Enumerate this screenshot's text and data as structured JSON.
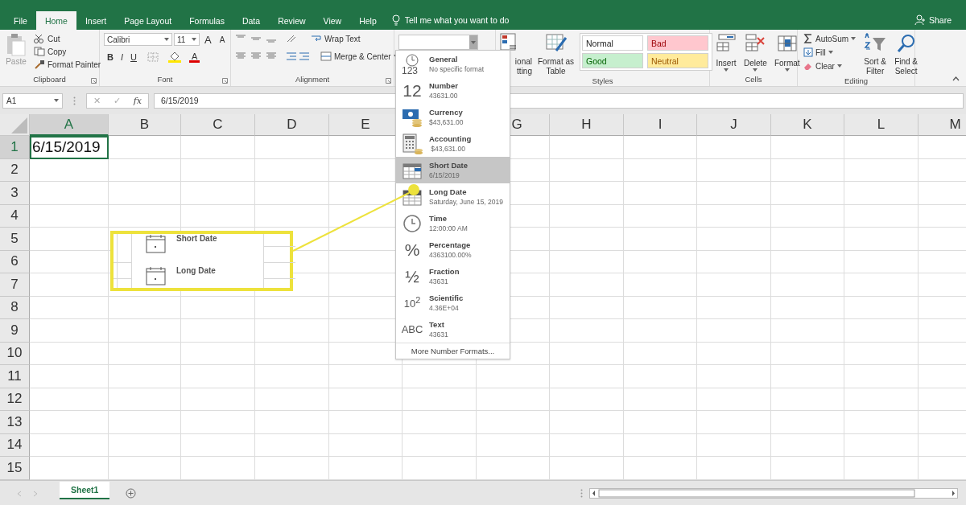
{
  "menu_tabs": [
    {
      "label": "File",
      "selected": false
    },
    {
      "label": "Home",
      "selected": true
    },
    {
      "label": "Insert",
      "selected": false
    },
    {
      "label": "Page Layout",
      "selected": false
    },
    {
      "label": "Formulas",
      "selected": false
    },
    {
      "label": "Data",
      "selected": false
    },
    {
      "label": "Review",
      "selected": false
    },
    {
      "label": "View",
      "selected": false
    },
    {
      "label": "Help",
      "selected": false
    }
  ],
  "tell_me": {
    "placeholder": "Tell me what you want to do"
  },
  "share": {
    "label": "Share"
  },
  "ribbon": [
    {
      "kind": "clipboard",
      "label": "Clipboard",
      "paste": {
        "label": "Paste",
        "disabled": true
      },
      "buttons": [
        {
          "kind": "cut",
          "label": "Cut"
        },
        {
          "kind": "copy",
          "label": "Copy"
        },
        {
          "kind": "painter",
          "label": "Format Painter"
        }
      ]
    },
    {
      "kind": "font",
      "label": "Font",
      "font_name": "Calibri",
      "font_size": "11",
      "size_buttons": [
        "A",
        "A"
      ],
      "style_buttons": [
        "B",
        "I",
        "U"
      ],
      "font_color_letter": "A"
    },
    {
      "kind": "alignment",
      "label": "Alignment",
      "wrap": "Wrap Text",
      "merge": "Merge & Center"
    },
    {
      "kind": "number"
    },
    {
      "kind": "styles",
      "label": "Styles",
      "conditional": [
        "ional",
        "tting"
      ],
      "format_table": [
        "Format as",
        "Table"
      ],
      "cell_styles": [
        {
          "kind": "normal",
          "label": "Normal",
          "color": "#ffffff"
        },
        {
          "kind": "bad",
          "label": "Bad",
          "color": "#ffc7ce"
        },
        {
          "kind": "good",
          "label": "Good",
          "color": "#c6efce"
        },
        {
          "kind": "neutral",
          "label": "Neutral",
          "color": "#ffeb9c"
        }
      ]
    },
    {
      "kind": "cells",
      "label": "Cells",
      "buttons": [
        {
          "kind": "insert",
          "label": "Insert"
        },
        {
          "kind": "delete",
          "label": "Delete"
        },
        {
          "kind": "format",
          "label": "Format"
        }
      ]
    },
    {
      "kind": "editing",
      "label": "Editing",
      "small": [
        {
          "kind": "sum",
          "label": "AutoSum"
        },
        {
          "kind": "fill",
          "label": "Fill"
        },
        {
          "kind": "clear",
          "label": "Clear"
        }
      ],
      "big": [
        {
          "kind": "sort",
          "lines": [
            "Sort &",
            "Filter"
          ]
        },
        {
          "kind": "find",
          "lines": [
            "Find &",
            "Select"
          ]
        }
      ]
    }
  ],
  "formula_bar": {
    "name_box": "A1",
    "cancel": "✕",
    "enter": "✓",
    "fx": "fx",
    "value": "6/15/2019"
  },
  "columns": [
    {
      "label": "A",
      "selected": true
    },
    {
      "label": "B",
      "selected": false
    },
    {
      "label": "C",
      "selected": false
    },
    {
      "label": "D",
      "selected": false
    },
    {
      "label": "E",
      "selected": false
    },
    {
      "label": "G",
      "selected": false
    },
    {
      "label": "H",
      "selected": false
    },
    {
      "label": "I",
      "selected": false
    },
    {
      "label": "J",
      "selected": false
    },
    {
      "label": "K",
      "selected": false
    },
    {
      "label": "L",
      "selected": false
    },
    {
      "label": "M",
      "selected": false
    }
  ],
  "rows": [
    {
      "label": "1",
      "selected": true,
      "cells": [
        "6/15/2019"
      ]
    },
    {
      "label": "2",
      "selected": false
    },
    {
      "label": "3",
      "selected": false
    },
    {
      "label": "4",
      "selected": false
    },
    {
      "label": "5",
      "selected": false
    },
    {
      "label": "6",
      "selected": false
    },
    {
      "label": "7",
      "selected": false
    },
    {
      "label": "8",
      "selected": false
    },
    {
      "label": "9",
      "selected": false
    },
    {
      "label": "10",
      "selected": false
    },
    {
      "label": "11",
      "selected": false
    },
    {
      "label": "12",
      "selected": false
    },
    {
      "label": "13",
      "selected": false
    },
    {
      "label": "14",
      "selected": false
    },
    {
      "label": "15",
      "selected": false
    }
  ],
  "format_menu": {
    "items": [
      {
        "kind": "general",
        "icon_text": "123",
        "name": "General",
        "sample": "No specific format",
        "selected": false
      },
      {
        "kind": "number",
        "icon_text": "12",
        "name": "Number",
        "sample": "43631.00",
        "selected": false
      },
      {
        "kind": "currency",
        "name": "Currency",
        "sample": "$43,631.00",
        "selected": false
      },
      {
        "kind": "accounting",
        "name": "Accounting",
        "sample": " $43,631.00",
        "selected": false
      },
      {
        "kind": "short_date",
        "name": "Short Date",
        "sample": "6/15/2019",
        "selected": true
      },
      {
        "kind": "long_date",
        "name": "Long Date",
        "sample": "Saturday, June 15, 2019",
        "selected": false
      },
      {
        "kind": "time",
        "name": "Time",
        "sample": "12:00:00 AM",
        "selected": false
      },
      {
        "kind": "percentage",
        "icon_text": "%",
        "name": "Percentage",
        "sample": "4363100.00%",
        "selected": false
      },
      {
        "kind": "fraction",
        "icon_text": "½",
        "name": "Fraction",
        "sample": "43631",
        "selected": false
      },
      {
        "kind": "scientific",
        "icon_text": "10$^{2}$",
        "name": "Scientific",
        "sample": "4.36E+04",
        "selected": false
      },
      {
        "kind": "text",
        "icon_text": "ABC",
        "name": "Text",
        "sample": "43631",
        "selected": false
      }
    ],
    "more": "More Number Formats..."
  },
  "callout": {
    "items": [
      "Short Date",
      "Long Date"
    ]
  },
  "sheets": [
    {
      "label": "Sheet1",
      "selected": true
    }
  ]
}
